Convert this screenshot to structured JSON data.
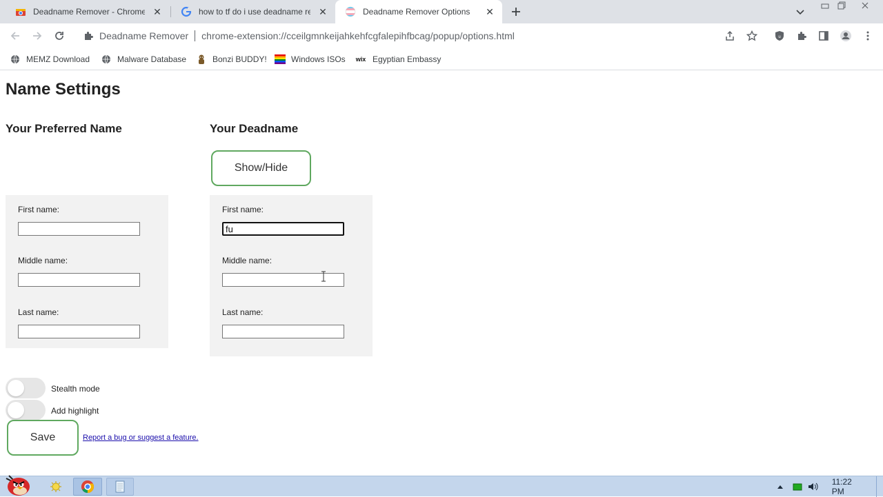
{
  "browser": {
    "tabs": [
      {
        "title": "Deadname Remover - Chrome W",
        "favicon": "chrome-web-store-icon",
        "active": false
      },
      {
        "title": "how to tf do i use deadname rem",
        "favicon": "google-icon",
        "active": false
      },
      {
        "title": "Deadname Remover Options",
        "favicon": "trans-flag-icon",
        "active": true
      }
    ],
    "omnibox": {
      "extension_name": "Deadname Remover",
      "url": "chrome-extension://cceilgmnkeijahkehfcgfalepihfbcag/popup/options.html"
    },
    "bookmarks": [
      {
        "label": "MEMZ Download",
        "icon": "globe-icon"
      },
      {
        "label": "Malware Database",
        "icon": "globe-icon"
      },
      {
        "label": "Bonzi BUDDY!",
        "icon": "bonzi-icon"
      },
      {
        "label": "Windows ISOs",
        "icon": "rainbow-flag-icon"
      },
      {
        "label": "Egyptian Embassy",
        "icon": "wix-icon"
      }
    ]
  },
  "page": {
    "title": "Name Settings",
    "preferred": {
      "heading": "Your Preferred Name",
      "first_label": "First name:",
      "first_value": "",
      "middle_label": "Middle name:",
      "middle_value": "",
      "last_label": "Last name:",
      "last_value": ""
    },
    "deadname": {
      "heading": "Your Deadname",
      "show_hide_label": "Show/Hide",
      "first_label": "First name:",
      "first_value": "fu",
      "middle_label": "Middle name:",
      "middle_value": "",
      "last_label": "Last name:",
      "last_value": ""
    },
    "toggles": [
      {
        "label": "Stealth mode",
        "on": false
      },
      {
        "label": "Add highlight",
        "on": false
      }
    ],
    "save_label": "Save",
    "report_link": "Report a bug or suggest a feature."
  },
  "taskbar": {
    "clock": "11:22 PM",
    "wix_text": "wix"
  },
  "colors": {
    "button_border": "#5fa85f",
    "panel_bg": "#f2f2f2",
    "taskbar_bg": "#c4d6ec",
    "tabstrip_bg": "#dee1e6"
  }
}
